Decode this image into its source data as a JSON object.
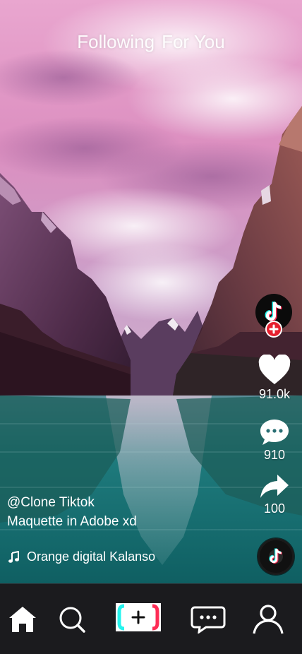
{
  "feed_tabs": {
    "following": "Following",
    "for_you": "For You"
  },
  "actions": {
    "likes": "91.0k",
    "comments": "910",
    "shares": "100"
  },
  "caption": {
    "username": "@Clone Tiktok",
    "description": "Maquette in Adobe xd"
  },
  "music": {
    "title": "Orange digital Kalanso"
  },
  "icons": {
    "avatar": "tiktok-logo-icon",
    "follow": "plus-icon",
    "like": "heart-icon",
    "comment": "chat-bubble-icon",
    "share": "share-arrow-icon",
    "music": "music-note-icon",
    "disc": "music-disc-icon",
    "home": "home-icon",
    "search": "search-icon",
    "create": "create-plus-icon",
    "inbox": "message-icon",
    "profile": "user-icon"
  },
  "colors": {
    "follow_badge": "#e6202f",
    "nav_background": "#1b1b1e",
    "tiktok_cyan": "#25f4ee",
    "tiktok_red": "#fe2c55"
  }
}
